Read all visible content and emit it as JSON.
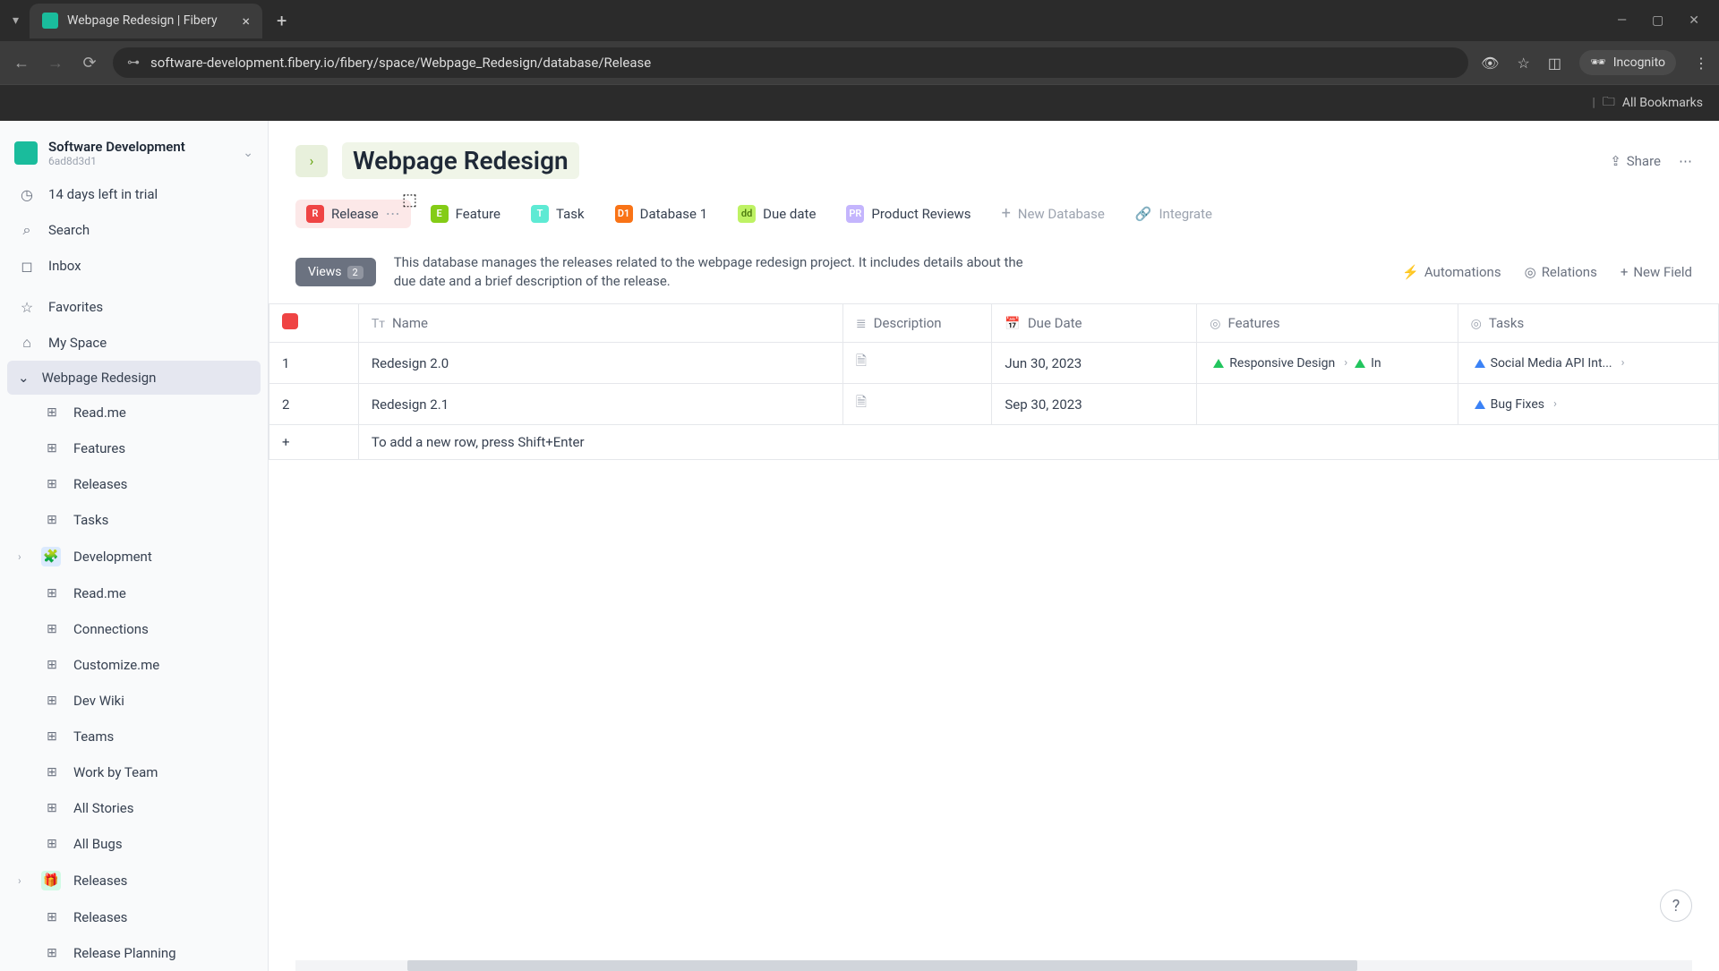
{
  "browser": {
    "tab_title": "Webpage Redesign | Fibery",
    "url": "software-development.fibery.io/fibery/space/Webpage_Redesign/database/Release",
    "incognito": "Incognito",
    "all_bookmarks": "All Bookmarks"
  },
  "workspace": {
    "name": "Software Development",
    "id": "6ad8d3d1"
  },
  "sidebar": {
    "trial": "14 days left in trial",
    "search": "Search",
    "inbox": "Inbox",
    "favorites": "Favorites",
    "my_space": "My Space",
    "spaces": [
      {
        "name": "Webpage Redesign",
        "active": true,
        "items": [
          "Read.me",
          "Features",
          "Releases",
          "Tasks"
        ]
      },
      {
        "name": "Development",
        "active": false,
        "items": [
          "Read.me",
          "Connections",
          "Customize.me",
          "Dev Wiki",
          "Teams",
          "Work by Team",
          "All Stories",
          "All Bugs"
        ]
      },
      {
        "name": "Releases",
        "active": false,
        "items": [
          "Releases",
          "Release Planning"
        ]
      }
    ]
  },
  "page": {
    "title": "Webpage Redesign",
    "share": "Share"
  },
  "db_tabs": [
    {
      "badge": "R",
      "badgeClass": "badge-R",
      "label": "Release",
      "active": true
    },
    {
      "badge": "E",
      "badgeClass": "badge-E",
      "label": "Feature",
      "active": false
    },
    {
      "badge": "T",
      "badgeClass": "badge-T",
      "label": "Task",
      "active": false
    },
    {
      "badge": "D1",
      "badgeClass": "badge-D1",
      "label": "Database 1",
      "active": false
    },
    {
      "badge": "dd",
      "badgeClass": "badge-dd",
      "label": "Due date",
      "active": false
    },
    {
      "badge": "PR",
      "badgeClass": "badge-PR",
      "label": "Product Reviews",
      "active": false
    }
  ],
  "db_actions": {
    "new_database": "New Database",
    "integrate": "Integrate"
  },
  "toolbar": {
    "views": "Views",
    "views_count": "2",
    "description": "This database manages the releases related to the webpage redesign project. It includes details about the due date and a brief description of the release.",
    "automations": "Automations",
    "relations": "Relations",
    "new_field": "New Field"
  },
  "table": {
    "columns": [
      "Name",
      "Description",
      "Due Date",
      "Features",
      "Tasks"
    ],
    "rows": [
      {
        "idx": "1",
        "name": "Redesign 2.0",
        "due": "Jun 30, 2023",
        "features": [
          {
            "label": "Responsive Design",
            "tri": "tri-green"
          },
          {
            "label": "In",
            "tri": "tri-green"
          }
        ],
        "tasks": [
          {
            "label": "Social Media API Int...",
            "tri": "tri-blue"
          }
        ]
      },
      {
        "idx": "2",
        "name": "Redesign 2.1",
        "due": "Sep 30, 2023",
        "features": [],
        "tasks": [
          {
            "label": "Bug Fixes",
            "tri": "tri-blue"
          }
        ]
      }
    ],
    "add_placeholder": "To add a new row, press Shift+Enter"
  }
}
